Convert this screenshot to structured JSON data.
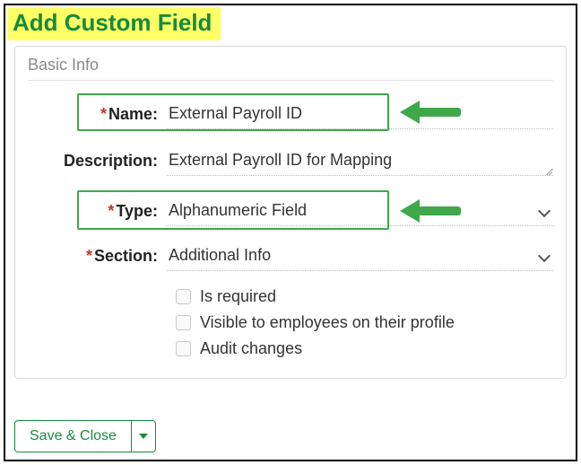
{
  "header": {
    "title": "Add Custom Field"
  },
  "panel": {
    "title": "Basic Info",
    "fields": {
      "name": {
        "label": "Name:",
        "value": "External Payroll ID",
        "required": true
      },
      "description": {
        "label": "Description:",
        "value": "External Payroll ID for Mapping",
        "required": false
      },
      "type": {
        "label": "Type:",
        "value": "Alphanumeric Field",
        "required": true
      },
      "section": {
        "label": "Section:",
        "value": "Additional Info",
        "required": true
      }
    },
    "checkboxes": {
      "required_label": "Is required",
      "visible_label": "Visible to employees on their profile",
      "audit_label": "Audit changes"
    }
  },
  "buttons": {
    "save_label": "Save & Close"
  }
}
